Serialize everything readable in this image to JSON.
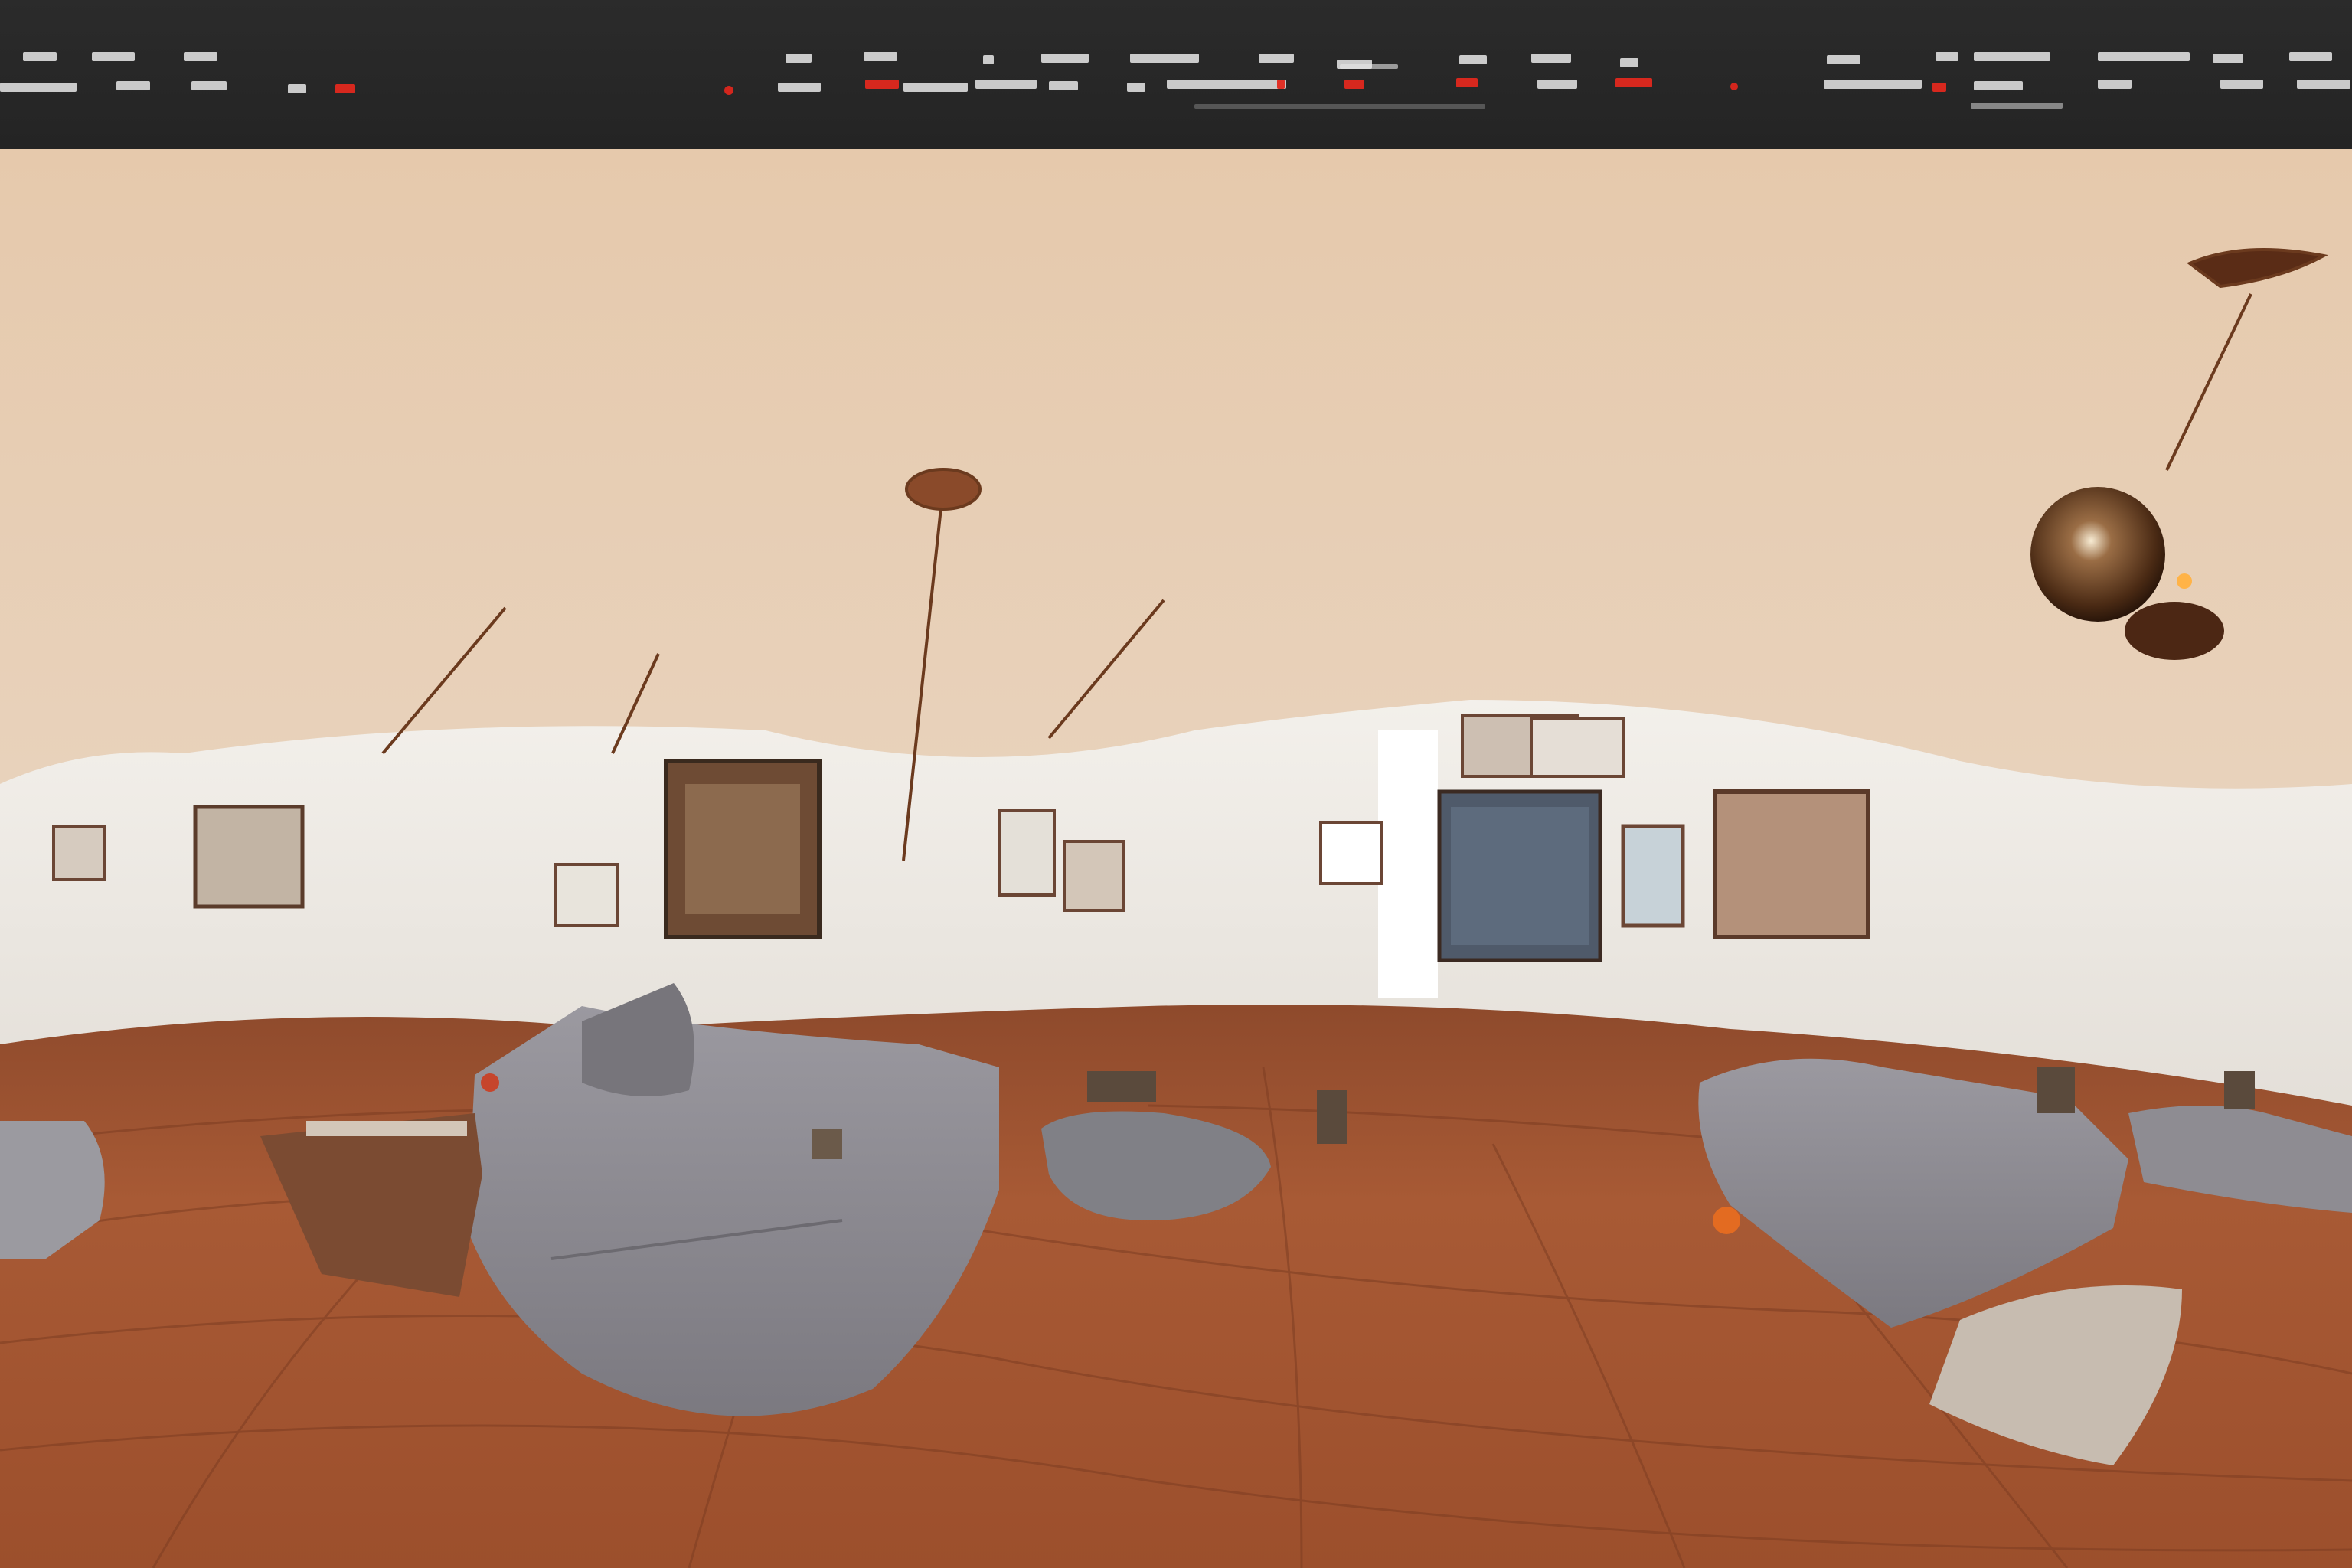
{
  "colors": {
    "topbar": "#262626",
    "ceiling": "#e7cdb3",
    "wall": "#ece8e1",
    "floor": "#a4532d",
    "sofa": "#8d8b90",
    "accent": "#e0281e"
  },
  "topbar": {
    "note": "",
    "glyph_rows": 2
  },
  "scene": {
    "icon": "panorama-icon"
  }
}
